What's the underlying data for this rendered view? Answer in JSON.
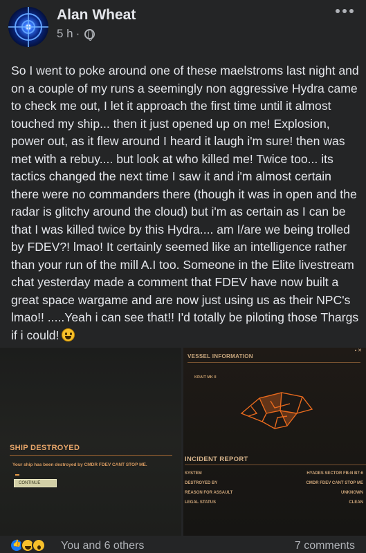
{
  "post": {
    "author": "Alan Wheat",
    "time": "5 h",
    "separator": "·",
    "privacy_icon": "friends-icon",
    "text": "So I went to poke around one of these maelstroms last night and on a couple of my runs a seemingly non aggressive Hydra came to check me out, I let it approach the first time until it almost touched my ship... then it just opened up on me! Explosion, power out, as it flew around I heard it laugh i'm sure! then was met with a rebuy.... but look at who killed me! Twice too... its tactics changed the next time I saw it and i'm almost certain there were no commanders there (though it was in open and the radar is glitchy around the cloud) but i'm as certain as I can be that I was killed twice by this Hydra.... am I/are we being trolled by FDEV?! lmao! It certainly seemed like an intelligence rather than your run of the mill A.I too. Someone in the Elite livestream chat yesterday made a comment that FDEV have now built a great space wargame and are now just using us as their NPC's lmao!! .....Yeah i can see that!! I'd totally be piloting those Thargs if i could!",
    "emoji": "grinning-face-icon"
  },
  "image_left": {
    "title": "SHIP DESTROYED",
    "message": "Your ship has been destroyed by CMDR FDEV CANT STOP ME.",
    "continue_label": "CONTINUE"
  },
  "image_right": {
    "vessel_title": "VESSEL INFORMATION",
    "ship_name": "KRAIT MK II",
    "incident_title": "INCIDENT REPORT",
    "rows": [
      {
        "label": "SYSTEM",
        "value": "HYADES SECTOR FB-N B7-6"
      },
      {
        "label": "DESTROYED BY",
        "value": "CMDR FDEV CANT STOP ME"
      },
      {
        "label": "REASON FOR ASSAULT",
        "value": "UNKNOWN"
      },
      {
        "label": "LEGAL STATUS",
        "value": "CLEAN"
      }
    ]
  },
  "footer": {
    "reactions": [
      "like-icon",
      "haha-icon",
      "wow-icon"
    ],
    "reaction_text": "You and 6 others",
    "comments_text": "7 comments"
  },
  "colors": {
    "background": "#242526",
    "text": "#e4e6eb",
    "secondary": "#b0b3b8",
    "elite_orange": "#e8a66a"
  }
}
